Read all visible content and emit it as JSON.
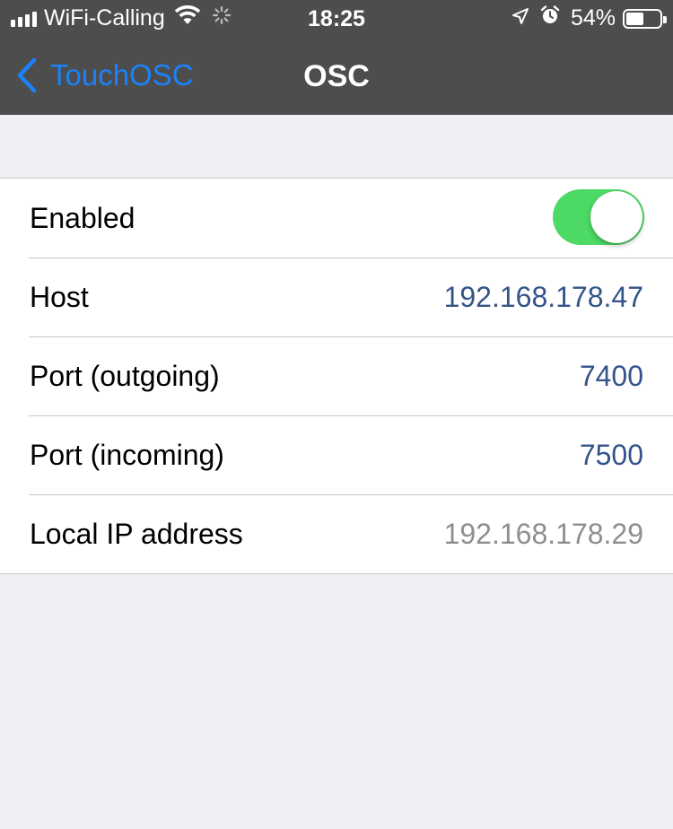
{
  "status_bar": {
    "carrier": "WiFi-Calling",
    "time": "18:25",
    "battery_percent": "54%",
    "battery_level": 0.54,
    "icons": [
      "signal-icon",
      "wifi-icon",
      "activity-icon",
      "location-icon",
      "alarm-icon",
      "battery-icon"
    ]
  },
  "nav": {
    "back_label": "TouchOSC",
    "title": "OSC"
  },
  "settings": {
    "enabled": {
      "label": "Enabled",
      "on": true
    },
    "host": {
      "label": "Host",
      "value": "192.168.178.47"
    },
    "port_out": {
      "label": "Port (outgoing)",
      "value": "7400"
    },
    "port_in": {
      "label": "Port (incoming)",
      "value": "7500"
    },
    "local_ip": {
      "label": "Local IP address",
      "value": "192.168.178.29"
    }
  },
  "colors": {
    "bar_background": "#4d4d4d",
    "accent_blue": "#1a82fb",
    "toggle_on": "#4cd964",
    "value_blue": "#34548a",
    "muted_gray": "#8e8e93",
    "grouped_background": "#efeff4"
  }
}
